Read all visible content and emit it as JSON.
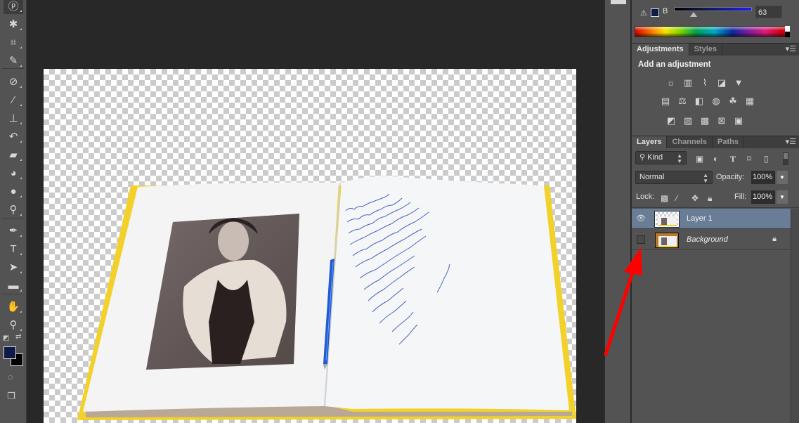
{
  "app": "Photoshop",
  "toolbar": {
    "tools": [
      {
        "name": "lasso-tool",
        "glyph": "ⓟ"
      },
      {
        "name": "magic-wand-tool",
        "glyph": "✱"
      },
      {
        "name": "crop-tool",
        "glyph": "⌗"
      },
      {
        "name": "eyedropper-tool",
        "glyph": "✎"
      },
      {
        "name": "healing-brush-tool",
        "glyph": "⊘"
      },
      {
        "name": "brush-tool",
        "glyph": "⁄"
      },
      {
        "name": "clone-stamp-tool",
        "glyph": "⊥"
      },
      {
        "name": "history-brush-tool",
        "glyph": "↶"
      },
      {
        "name": "eraser-tool",
        "glyph": "▰"
      },
      {
        "name": "paint-bucket-tool",
        "glyph": "◕"
      },
      {
        "name": "blur-tool",
        "glyph": "●"
      },
      {
        "name": "dodge-tool",
        "glyph": "⚲"
      },
      {
        "name": "pen-tool",
        "glyph": "✒"
      },
      {
        "name": "type-tool",
        "glyph": "T"
      },
      {
        "name": "path-selection-tool",
        "glyph": "➤"
      },
      {
        "name": "rectangle-tool",
        "glyph": "▬"
      },
      {
        "name": "hand-tool",
        "glyph": "✋"
      },
      {
        "name": "zoom-tool",
        "glyph": "⚲"
      }
    ],
    "foreground_color": "#0f1a46",
    "background_color": "#000000"
  },
  "color_panel": {
    "channel": "B",
    "channel_value": "63"
  },
  "adjustments_panel": {
    "tabs": [
      "Adjustments",
      "Styles"
    ],
    "title": "Add an adjustment",
    "rows": [
      [
        {
          "name": "brightness-contrast-icon",
          "glyph": "☼"
        },
        {
          "name": "levels-icon",
          "glyph": "▥"
        },
        {
          "name": "curves-icon",
          "glyph": "⌇"
        },
        {
          "name": "exposure-icon",
          "glyph": "◪"
        },
        {
          "name": "vibrance-icon",
          "glyph": "▼"
        }
      ],
      [
        {
          "name": "hue-saturation-icon",
          "glyph": "▤"
        },
        {
          "name": "color-balance-icon",
          "glyph": "⚖"
        },
        {
          "name": "black-white-icon",
          "glyph": "◧"
        },
        {
          "name": "photo-filter-icon",
          "glyph": "◍"
        },
        {
          "name": "channel-mixer-icon",
          "glyph": "☘"
        },
        {
          "name": "color-lookup-icon",
          "glyph": "▦"
        }
      ],
      [
        {
          "name": "invert-icon",
          "glyph": "◩"
        },
        {
          "name": "posterize-icon",
          "glyph": "▨"
        },
        {
          "name": "threshold-icon",
          "glyph": "▩"
        },
        {
          "name": "selective-color-icon",
          "glyph": "⊠"
        },
        {
          "name": "gradient-map-icon",
          "glyph": "▣"
        }
      ]
    ]
  },
  "layers_panel": {
    "tabs": [
      "Layers",
      "Channels",
      "Paths"
    ],
    "filter_label": "Kind",
    "blend_mode": "Normal",
    "opacity_label": "Opacity:",
    "opacity_value": "100%",
    "lock_label": "Lock:",
    "fill_label": "Fill:",
    "fill_value": "100%",
    "layers": [
      {
        "name": "Layer 1",
        "visible": true,
        "selected": true,
        "locked": false
      },
      {
        "name": "Background",
        "visible": false,
        "selected": false,
        "locked": true
      }
    ]
  },
  "annotation": {
    "type": "red-arrow",
    "color": "#ff0000",
    "points_to": "Background layer visibility toggle"
  }
}
